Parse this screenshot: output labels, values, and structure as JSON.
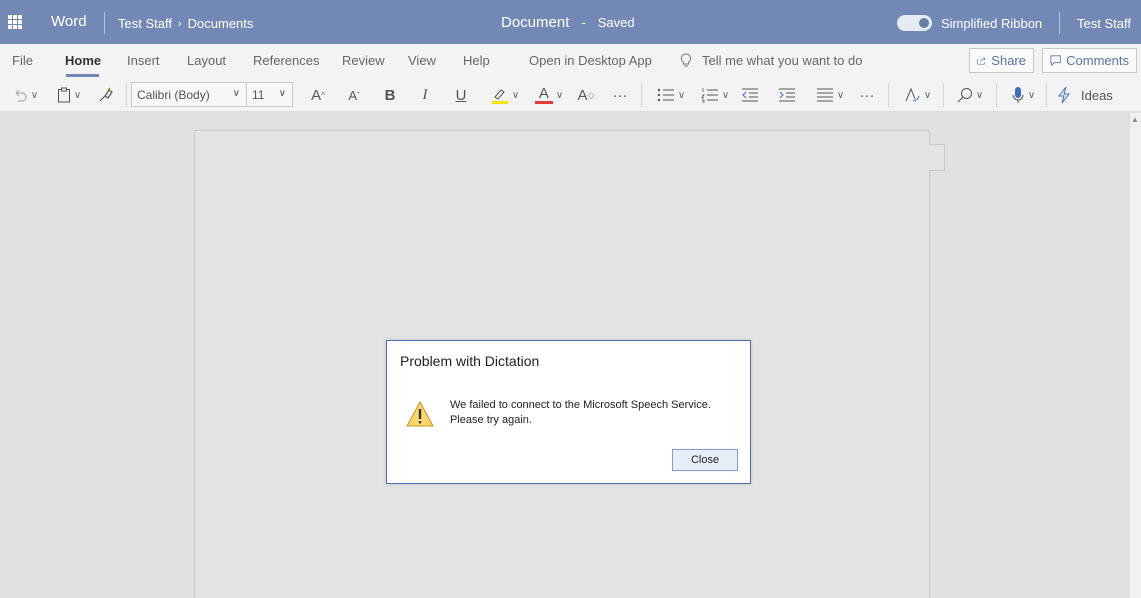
{
  "titlebar": {
    "app_name": "Word",
    "breadcrumb_user": "Test Staff",
    "breadcrumb_folder": "Documents",
    "doc_title": "Document",
    "doc_sep": "-",
    "doc_status": "Saved",
    "ribbon_toggle_label": "Simplified Ribbon",
    "user_name": "Test Staff",
    "bg_color": "#7289b5"
  },
  "tabs": {
    "items": [
      "File",
      "Home",
      "Insert",
      "Layout",
      "References",
      "Review",
      "View",
      "Help",
      "Open in Desktop App"
    ],
    "active": "Home",
    "tell_me_placeholder": "Tell me what you want to do",
    "share_label": "Share",
    "comments_label": "Comments"
  },
  "toolbar": {
    "font_name": "Calibri (Body)",
    "font_size": "11",
    "ideas_label": "Ideas",
    "grow_font": "A",
    "shrink_font": "A",
    "bold": "B",
    "italic": "I",
    "underline": "U",
    "font_color": "A",
    "clear_format": "A",
    "more": "···"
  },
  "dialog": {
    "title": "Problem with Dictation",
    "message_line1": "We failed to connect to the Microsoft Speech Service.",
    "message_line2": "Please try again.",
    "close_label": "Close",
    "icon": "warning-icon"
  }
}
